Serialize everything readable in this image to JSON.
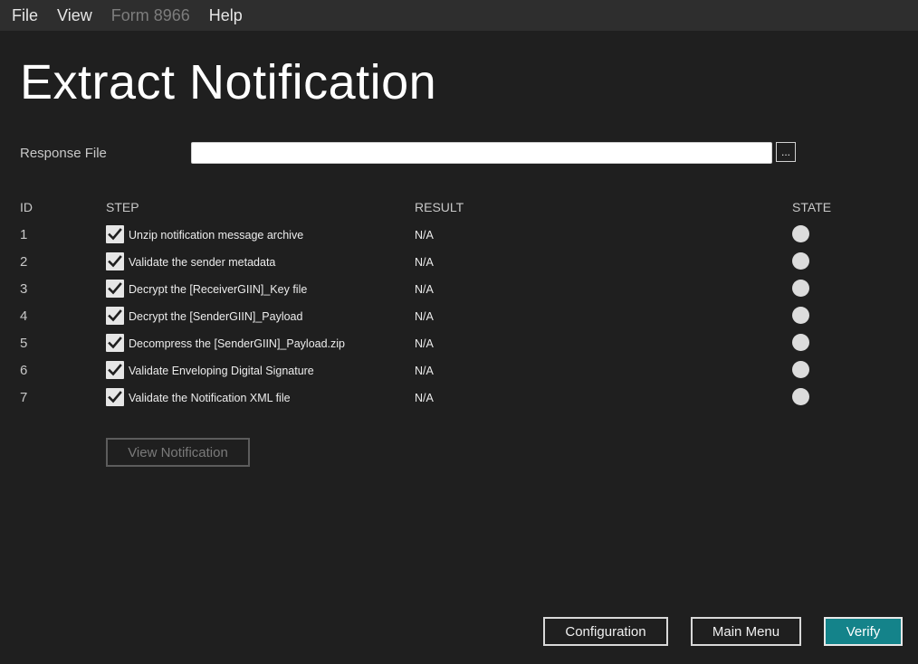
{
  "menu": {
    "file": "File",
    "view": "View",
    "form": "Form 8966",
    "help": "Help"
  },
  "page_title": "Extract Notification",
  "response_file": {
    "label": "Response File",
    "value": "",
    "browse_label": "..."
  },
  "table": {
    "headers": {
      "id": "ID",
      "step": "STEP",
      "result": "RESULT",
      "state": "STATE"
    },
    "rows": [
      {
        "id": "1",
        "step": "Unzip notification message archive",
        "checked": true,
        "result": "N/A"
      },
      {
        "id": "2",
        "step": "Validate the sender metadata",
        "checked": true,
        "result": "N/A"
      },
      {
        "id": "3",
        "step": "Decrypt the [ReceiverGIIN]_Key file",
        "checked": true,
        "result": "N/A"
      },
      {
        "id": "4",
        "step": "Decrypt the [SenderGIIN]_Payload",
        "checked": true,
        "result": "N/A"
      },
      {
        "id": "5",
        "step": "Decompress the [SenderGIIN]_Payload.zip",
        "checked": true,
        "result": "N/A"
      },
      {
        "id": "6",
        "step": "Validate Enveloping Digital Signature",
        "checked": true,
        "result": "N/A"
      },
      {
        "id": "7",
        "step": "Validate the Notification XML file",
        "checked": true,
        "result": "N/A"
      }
    ]
  },
  "view_notification_label": "View Notification",
  "footer": {
    "configuration": "Configuration",
    "main_menu": "Main Menu",
    "verify": "Verify"
  },
  "colors": {
    "background": "#1f1f1f",
    "accent": "#14838a",
    "state_idle": "#dcdcdc"
  }
}
